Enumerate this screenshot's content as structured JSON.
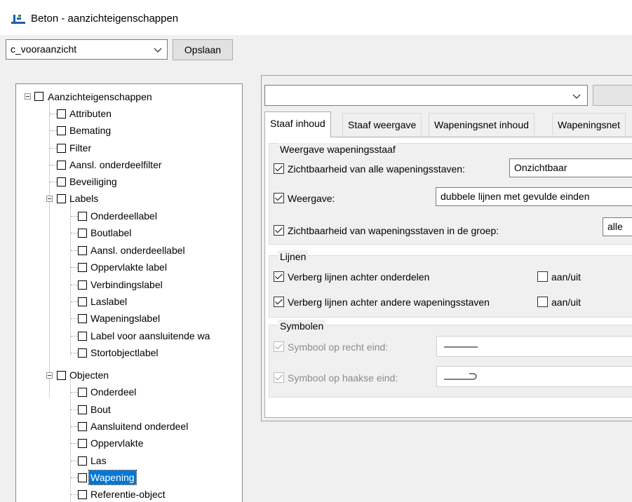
{
  "window": {
    "title": "Beton - aanzichteigenschappen",
    "icon": "reinforcement-app-icon"
  },
  "toolbar": {
    "view_combo_value": "c_vooraanzicht",
    "save_label": "Opslaan"
  },
  "tree": {
    "root": "Aanzichteigenschappen",
    "level1a": [
      "Attributen",
      "Bemating",
      "Filter",
      "Aansl. onderdeelfilter",
      "Beveiliging"
    ],
    "labels_group": "Labels",
    "labels_items": [
      "Onderdeellabel",
      "Boutlabel",
      "Aansl. onderdeellabel",
      "Oppervlakte label",
      "Verbindingslabel",
      "Laslabel",
      "Wapeningslabel",
      "Label voor aansluitende wa",
      "Stortobjectlabel"
    ],
    "objects_group": "Objecten",
    "objects_items": [
      "Onderdeel",
      "Bout",
      "Aansluitend onderdeel",
      "Oppervlakte",
      "Las",
      "Wapening",
      "Referentie-object"
    ],
    "selected": "Wapening"
  },
  "right": {
    "top_combo_value": "",
    "tabs": [
      "Staaf inhoud",
      "Staaf weergave",
      "Wapeningsnet inhoud",
      "Wapeningsnet"
    ],
    "active_tab": "Staaf inhoud",
    "group_display": {
      "title": "Weergave wapeningsstaaf",
      "visibility_label": "Zichtbaarheid van alle wapeningsstaven:",
      "visibility_value": "Onzichtbaar",
      "display_label": "Weergave:",
      "display_value": "dubbele lijnen met gevulde einden",
      "group_visibility_label": "Zichtbaarheid van wapeningsstaven in de groep:",
      "group_visibility_value": "alle"
    },
    "group_lines": {
      "title": "Lijnen",
      "hide_behind_parts": "Verberg lijnen achter onderdelen",
      "hide_behind_rebars": "Verberg lijnen achter andere wapeningsstaven",
      "toggle_label": "aan/uit"
    },
    "group_symbols": {
      "title": "Symbolen",
      "straight_end": "Symbool op recht eind:",
      "hook_end": "Symbool op haakse eind:"
    }
  },
  "colors": {
    "selection": "#0078d7",
    "window_bg": "#f0f0f0"
  }
}
